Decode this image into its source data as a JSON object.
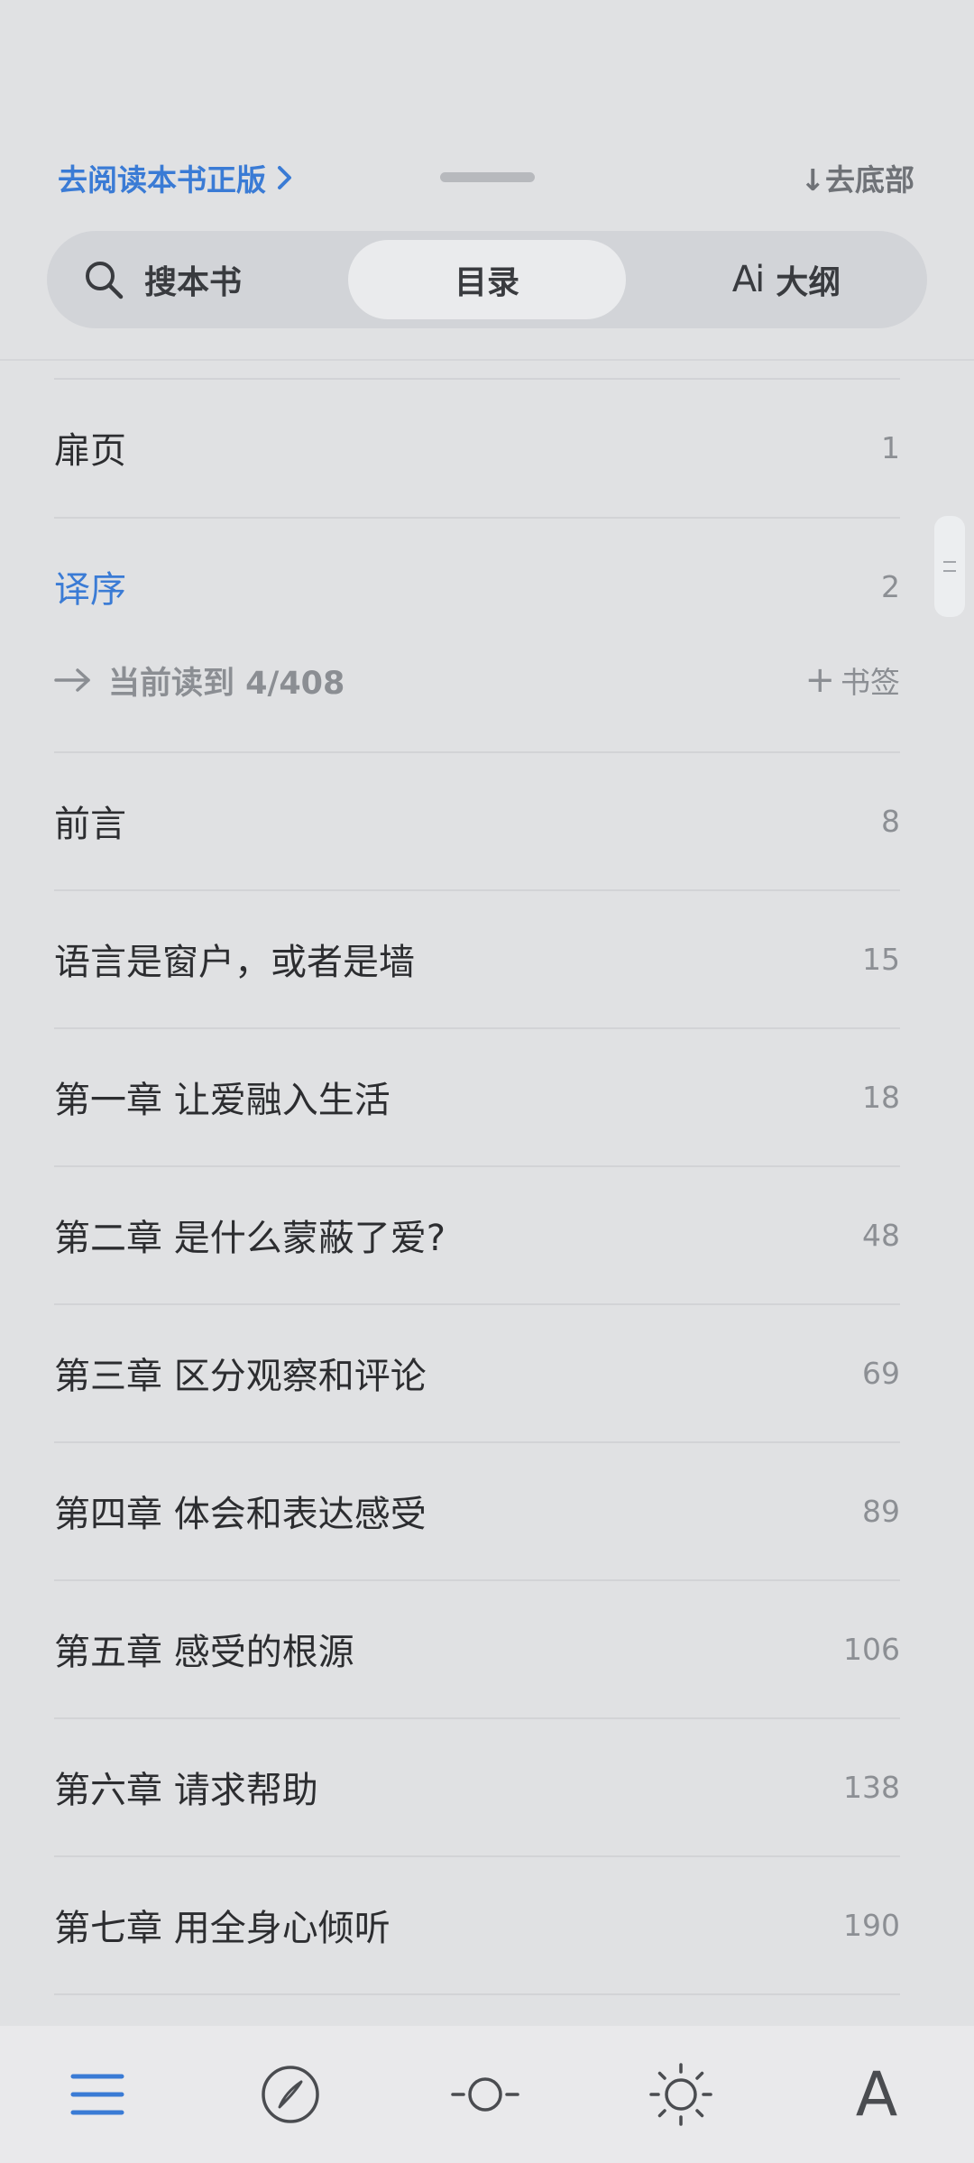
{
  "header": {
    "read_official_label": "去阅读本书正版",
    "to_bottom_label": "↓去底部"
  },
  "tabs": {
    "search_label": "搜本书",
    "toc_label": "目录",
    "outline_label": "大纲",
    "outline_icon_text": "Ai",
    "selected": "目录"
  },
  "toc": {
    "items": [
      {
        "title": "扉页",
        "page": "1"
      },
      {
        "title": "译序",
        "page": "2"
      },
      {
        "title": "前言",
        "page": "8"
      },
      {
        "title": "语言是窗户，或者是墙",
        "page": "15"
      },
      {
        "title": "第一章 让爱融入生活",
        "page": "18"
      },
      {
        "title": "第二章 是什么蒙蔽了爱?",
        "page": "48"
      },
      {
        "title": "第三章 区分观察和评论",
        "page": "69"
      },
      {
        "title": "第四章 体会和表达感受",
        "page": "89"
      },
      {
        "title": "第五章 感受的根源",
        "page": "106"
      },
      {
        "title": "第六章 请求帮助",
        "page": "138"
      },
      {
        "title": "第七章 用全身心倾听",
        "page": "190"
      }
    ],
    "current_reading": "当前读到 4/408",
    "bookmark_label": "书签"
  },
  "bottom_bar": {
    "font_label": "A"
  },
  "colors": {
    "accent": "#3a7bd5",
    "background": "#e0e1e3"
  }
}
